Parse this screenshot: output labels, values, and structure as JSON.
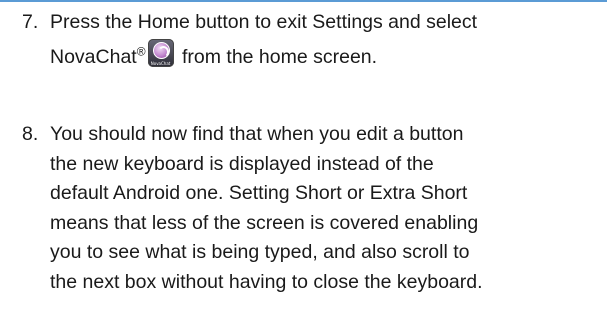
{
  "steps": [
    {
      "number": "7.",
      "lines": [
        "Press the Home button to exit Settings and select",
        {
          "before": "NovaChat",
          "sup": "®",
          "after": " from the home screen."
        }
      ],
      "icon": {
        "name": "novachat-app-icon",
        "caption": "NovaChat"
      }
    },
    {
      "number": "8.",
      "lines": [
        "You should now find that when you edit a button",
        "the new keyboard is displayed instead of the",
        "default Android one.  Setting Short or Extra Short",
        "means that less of the screen is covered enabling",
        "you to see what is being typed, and also scroll to",
        "the next box without having to close the keyboard."
      ]
    }
  ],
  "colors": {
    "top_rule": "#5b9bd5",
    "text": "#1a1a1a"
  }
}
